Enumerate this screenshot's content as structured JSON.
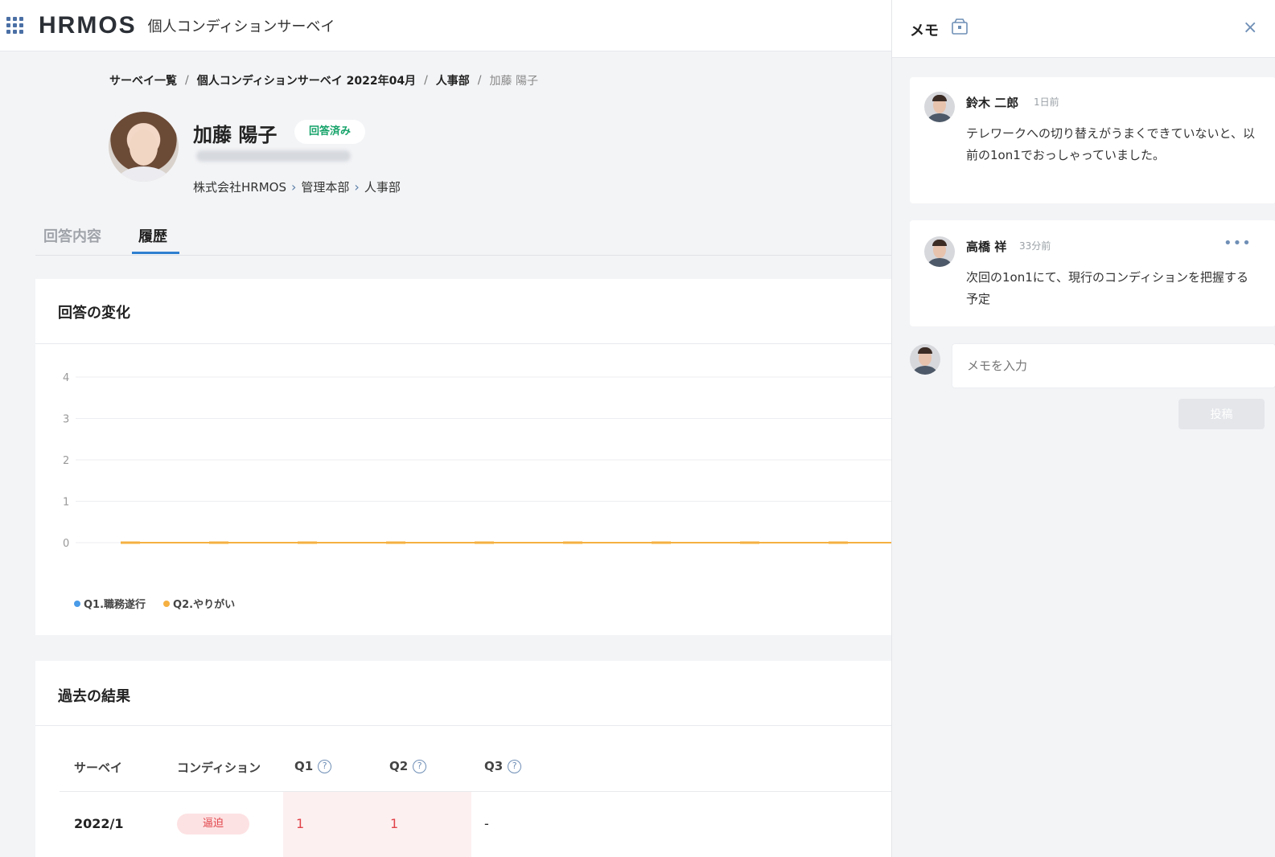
{
  "header": {
    "logo": "HRMOS",
    "app_title": "個人コンディションサーベイ"
  },
  "breadcrumb": {
    "items": [
      "サーベイ一覧",
      "個人コンディションサーベイ 2022年04月",
      "人事部"
    ],
    "current": "加藤 陽子",
    "separator": "/"
  },
  "profile": {
    "name": "加藤 陽子",
    "status_badge": "回答済み",
    "org_path": [
      "株式会社HRMOS",
      "管理本部",
      "人事部"
    ]
  },
  "tabs": [
    {
      "label": "回答内容",
      "active": false
    },
    {
      "label": "履歴",
      "active": true
    }
  ],
  "change_card": {
    "title": "回答の変化",
    "legend": [
      {
        "label": "Q1.職務遂行",
        "color": "#4a9be8"
      },
      {
        "label": "Q2.やりがい",
        "color": "#f5b041"
      }
    ]
  },
  "chart_data": {
    "type": "line",
    "y_ticks": [
      "4",
      "3",
      "2",
      "1",
      "0"
    ],
    "ylim": [
      0,
      4
    ],
    "grid": true,
    "legend_position": "bottom-left",
    "series": [
      {
        "name": "Q1.職務遂行",
        "color": "#4a9be8",
        "values": [
          0,
          0,
          0,
          0,
          0,
          0,
          0,
          0,
          0,
          0
        ]
      },
      {
        "name": "Q2.やりがい",
        "color": "#f5b041",
        "values": [
          0,
          0,
          0,
          0,
          0,
          0,
          0,
          0,
          0,
          0
        ]
      }
    ]
  },
  "past_results": {
    "title": "過去の結果",
    "columns": [
      "サーベイ",
      "コンディション",
      "Q1",
      "Q2",
      "Q3"
    ],
    "rows": [
      {
        "survey": "2022/1",
        "condition": "逼迫",
        "q1": "1",
        "q2": "1",
        "q3": "-"
      }
    ]
  },
  "memo_panel": {
    "title": "メモ",
    "close": "×",
    "memos": [
      {
        "author": "鈴木 二郎",
        "time": "1日前",
        "text": "テレワークへの切り替えがうまくできていないと、以前の1on1でおっしゃっていました。"
      },
      {
        "author": "高橋 祥",
        "time": "33分前",
        "text": "次回の1on1にて、現行のコンディションを把握する予定",
        "more": "•••"
      }
    ],
    "input_placeholder": "メモを入力",
    "post_label": "投稿"
  }
}
